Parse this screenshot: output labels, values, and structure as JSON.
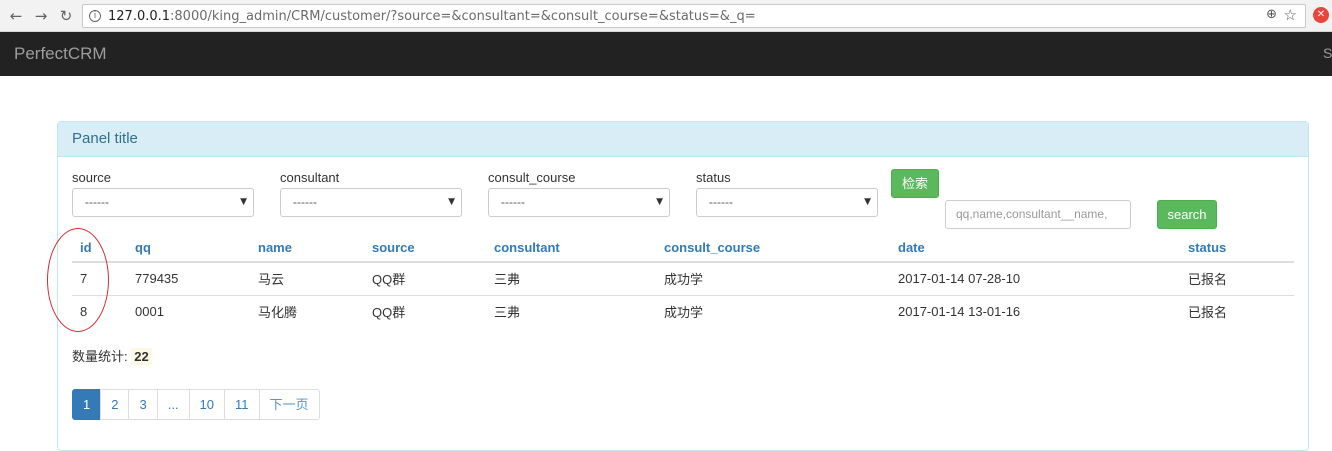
{
  "browser": {
    "url_host": "127.0.0.1",
    "url_rest": ":8000/king_admin/CRM/customer/?source=&consultant=&consult_course=&status=&_q=",
    "back": "←",
    "forward": "→",
    "reload": "↻",
    "info": "i",
    "zoom": "⊕",
    "star": "☆",
    "ext": "✕"
  },
  "navbar": {
    "brand": "PerfectCRM",
    "right_text": "S"
  },
  "panel": {
    "title": "Panel title"
  },
  "filters": [
    {
      "label": "source",
      "value": "------"
    },
    {
      "label": "consultant",
      "value": "------"
    },
    {
      "label": "consult_course",
      "value": "------"
    },
    {
      "label": "status",
      "value": "------"
    }
  ],
  "filter_arrow": "▼",
  "filter_button": "检索",
  "search": {
    "placeholder": "qq,name,consultant__name,",
    "button": "search"
  },
  "table": {
    "headers": [
      "id",
      "qq",
      "name",
      "source",
      "consultant",
      "consult_course",
      "date",
      "status"
    ],
    "rows": [
      [
        "7",
        "779435",
        "马云",
        "QQ群",
        "三弗",
        "成功学",
        "2017-01-14 07-28-10",
        "已报名"
      ],
      [
        "8",
        "0001",
        "马化腾",
        "QQ群",
        "三弗",
        "成功学",
        "2017-01-14 13-01-16",
        "已报名"
      ]
    ]
  },
  "count": {
    "label": "数量统计:",
    "value": "22"
  },
  "pagination": [
    "1",
    "2",
    "3",
    "...",
    "10",
    "11",
    "下一页"
  ],
  "colors": {
    "navbar": "#222222",
    "panel_heading": "#d9edf7",
    "link": "#337ab7",
    "success": "#5cb85c",
    "annotation": "#d32f2f"
  }
}
